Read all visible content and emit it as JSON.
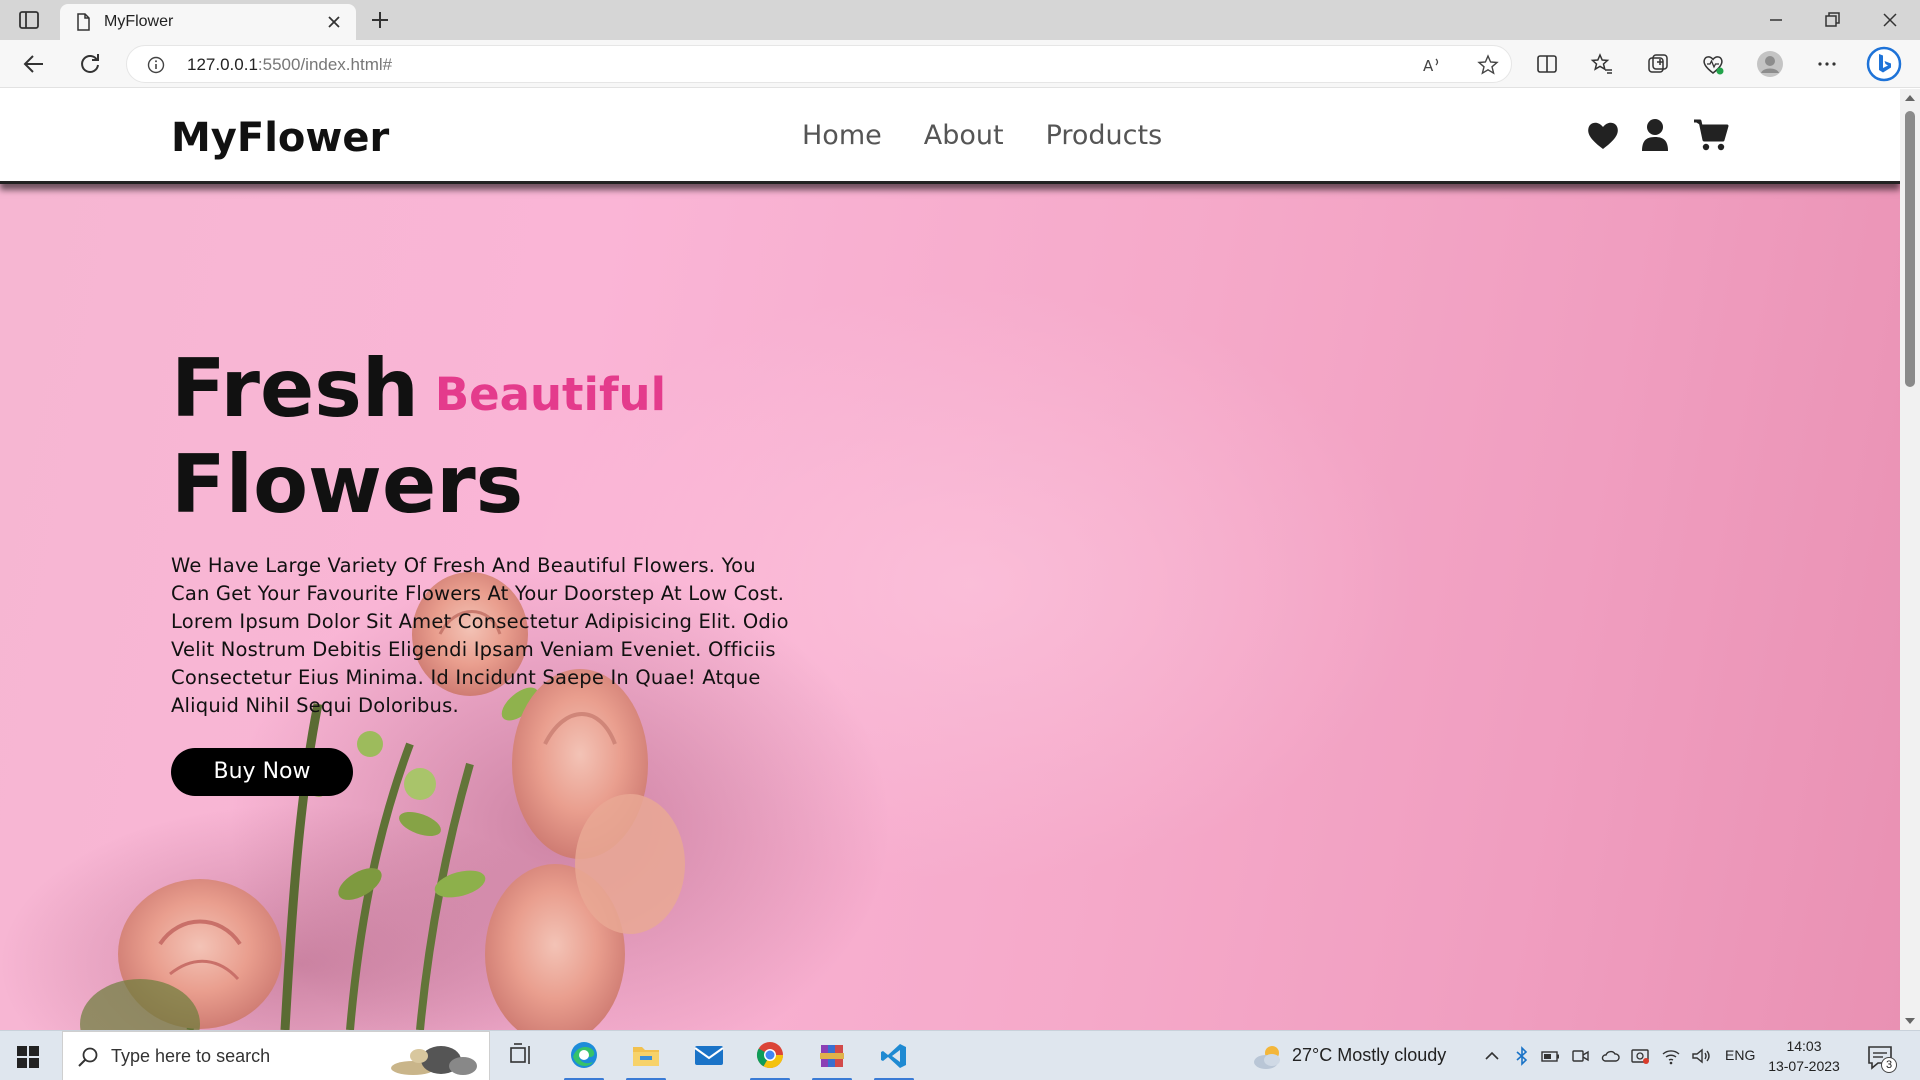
{
  "browser": {
    "tab_title": "MyFlower",
    "url_host": "127.0.0.1",
    "url_rest": ":5500/index.html#"
  },
  "site": {
    "logo": "MyFlower",
    "nav": [
      {
        "label": "Home"
      },
      {
        "label": "About"
      },
      {
        "label": "Products"
      }
    ],
    "header_icons": [
      "heart-icon",
      "user-icon",
      "cart-icon"
    ]
  },
  "hero": {
    "title_word1": "Fresh",
    "title_accent": "Beautiful",
    "title_word2": "Flowers",
    "description": "We Have Large Variety Of Fresh And Beautiful Flowers. You Can Get Your Favourite Flowers At Your Doorstep At Low Cost. Lorem Ipsum Dolor Sit Amet Consectetur Adipisicing Elit. Odio Velit Nostrum Debitis Eligendi Ipsam Veniam Eveniet. Officiis Consectetur Eius Minima. Id Incidunt Saepe In Quae! Atque Aliquid Nihil Sequi Doloribus.",
    "button_label": "Buy Now",
    "accent_color": "#e43b8c",
    "background_color": "#f6b2cf"
  },
  "taskbar": {
    "search_placeholder": "Type here to search",
    "weather": "27°C  Mostly cloudy",
    "language": "ENG",
    "time": "14:03",
    "date": "13-07-2023",
    "notification_count": "3"
  }
}
